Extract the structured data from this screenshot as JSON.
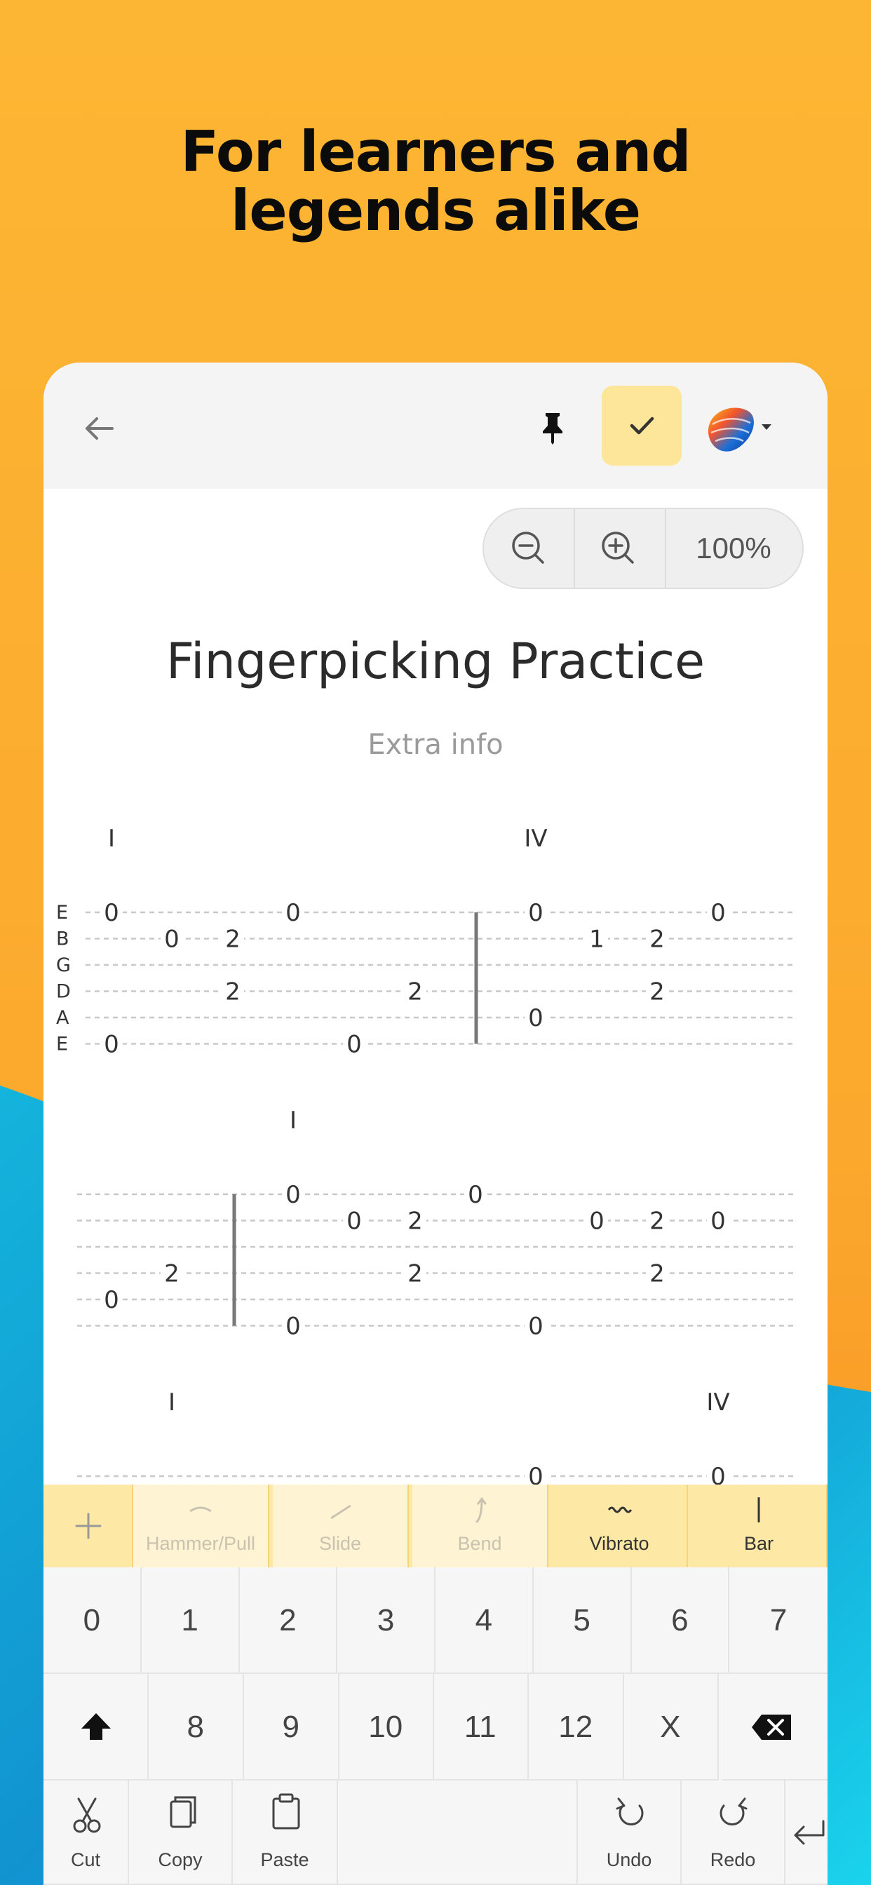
{
  "headline": {
    "line1": "For learners and",
    "line2": "legends alike"
  },
  "colors": {
    "accent": "#fde59a",
    "strip": "#fde8a6",
    "bg_top": "#fbb032",
    "bg_bottom": "#0ea5d8"
  },
  "toolbar": {
    "back_icon": "arrow-left-icon",
    "pin_icon": "pushpin-icon",
    "confirm_icon": "checkmark-icon",
    "app_menu_icon": "app-logo-icon"
  },
  "zoom": {
    "out_icon": "zoom-out-icon",
    "in_icon": "zoom-in-icon",
    "level": "100%"
  },
  "document": {
    "title": "Fingerpicking Practice",
    "subtitle": "Extra info"
  },
  "tab": {
    "string_names": [
      "E",
      "B",
      "G",
      "D",
      "A",
      "E"
    ],
    "lines": [
      {
        "top_ys": "row1",
        "roman": [
          {
            "text": "I",
            "col": 0
          },
          {
            "text": "IV",
            "col": 7
          }
        ],
        "bars": [
          6
        ],
        "notes": [
          {
            "col": 0,
            "string": 0,
            "fret": "0"
          },
          {
            "col": 0,
            "string": 5,
            "fret": "0"
          },
          {
            "col": 1,
            "string": 1,
            "fret": "0"
          },
          {
            "col": 2,
            "string": 1,
            "fret": "2"
          },
          {
            "col": 2,
            "string": 3,
            "fret": "2"
          },
          {
            "col": 3,
            "string": 0,
            "fret": "0"
          },
          {
            "col": 4,
            "string": 5,
            "fret": "0"
          },
          {
            "col": 5,
            "string": 3,
            "fret": "2"
          },
          {
            "col": 7,
            "string": 0,
            "fret": "0"
          },
          {
            "col": 7,
            "string": 4,
            "fret": "0"
          },
          {
            "col": 8,
            "string": 1,
            "fret": "1"
          },
          {
            "col": 9,
            "string": 1,
            "fret": "2"
          },
          {
            "col": 9,
            "string": 3,
            "fret": "2"
          },
          {
            "col": 10,
            "string": 0,
            "fret": "0"
          }
        ]
      },
      {
        "roman": [
          {
            "text": "I",
            "col": 3
          }
        ],
        "bars": [
          2
        ],
        "notes": [
          {
            "col": 0,
            "string": 4,
            "fret": "0"
          },
          {
            "col": 1,
            "string": 3,
            "fret": "2"
          },
          {
            "col": 3,
            "string": 0,
            "fret": "0"
          },
          {
            "col": 3,
            "string": 5,
            "fret": "0"
          },
          {
            "col": 4,
            "string": 1,
            "fret": "0"
          },
          {
            "col": 5,
            "string": 1,
            "fret": "2"
          },
          {
            "col": 5,
            "string": 3,
            "fret": "2"
          },
          {
            "col": 6,
            "string": 0,
            "fret": "0"
          },
          {
            "col": 7,
            "string": 5,
            "fret": "0"
          },
          {
            "col": 8,
            "string": 1,
            "fret": "0"
          },
          {
            "col": 9,
            "string": 1,
            "fret": "2"
          },
          {
            "col": 9,
            "string": 3,
            "fret": "2"
          },
          {
            "col": 10,
            "string": 1,
            "fret": "0"
          }
        ]
      },
      {
        "roman": [
          {
            "text": "I",
            "col": 1
          },
          {
            "text": "IV",
            "col": 10
          }
        ],
        "bars": [],
        "notes": [
          {
            "col": 7,
            "string": 0,
            "fret": "0"
          },
          {
            "col": 10,
            "string": 0,
            "fret": "0"
          }
        ]
      }
    ]
  },
  "techniques": [
    {
      "label": "Hammer/Pull",
      "icon": "hammer-pull-icon",
      "enabled": false
    },
    {
      "label": "Slide",
      "icon": "slide-icon",
      "enabled": false
    },
    {
      "label": "Bend",
      "icon": "bend-icon",
      "enabled": false
    },
    {
      "label": "Vibrato",
      "icon": "vibrato-icon",
      "enabled": true
    },
    {
      "label": "Bar",
      "icon": "bar-line-icon",
      "enabled": true
    }
  ],
  "keypad": {
    "row1": [
      "0",
      "1",
      "2",
      "3",
      "4",
      "5",
      "6",
      "7"
    ],
    "row2": [
      "8",
      "9",
      "10",
      "11",
      "12",
      "X"
    ],
    "shift_icon": "shift-up-icon",
    "backspace_icon": "backspace-icon",
    "add_icon": "plus-icon",
    "cut": "Cut",
    "copy": "Copy",
    "paste": "Paste",
    "undo": "Undo",
    "redo": "Redo",
    "enter_icon": "enter-return-icon"
  }
}
